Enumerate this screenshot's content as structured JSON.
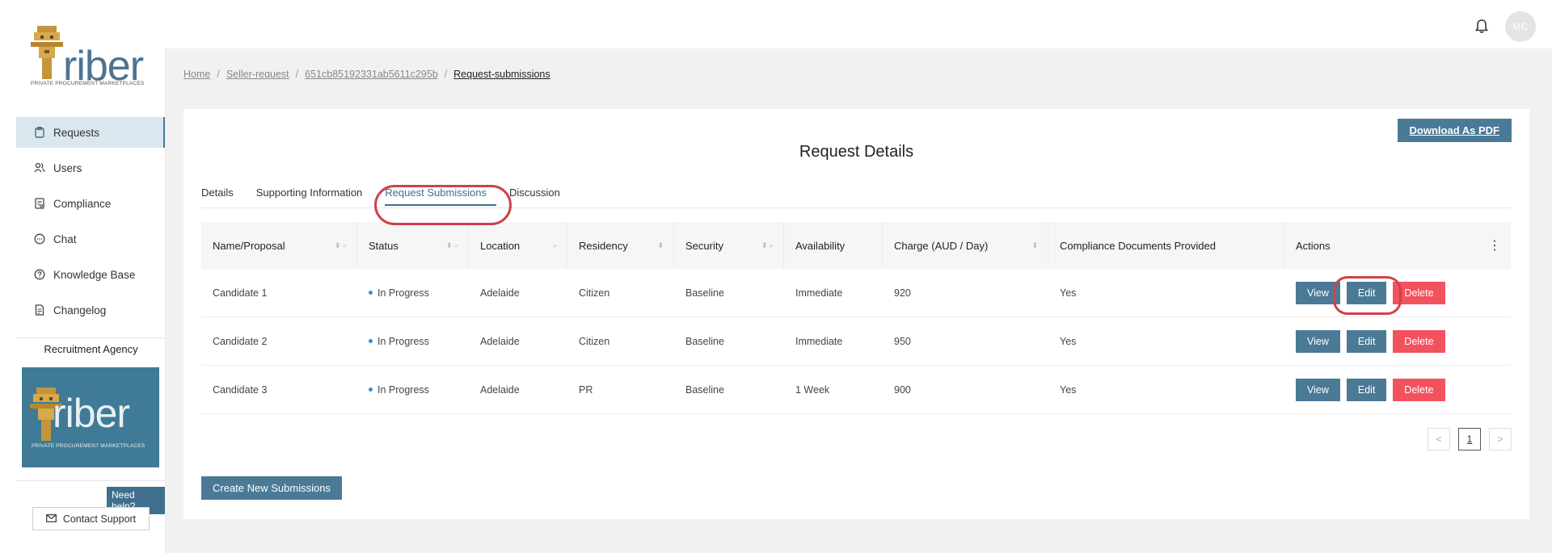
{
  "header": {
    "avatar_initials": "MC"
  },
  "brand": {
    "logo_text": "riber",
    "logo_sub": "PRIVATE PROCUREMENT MARKETPLACES"
  },
  "sidebar": {
    "items": [
      {
        "label": "Requests",
        "icon": "clipboard-icon",
        "active": true
      },
      {
        "label": "Users",
        "icon": "users-icon",
        "active": false
      },
      {
        "label": "Compliance",
        "icon": "compliance-icon",
        "active": false
      },
      {
        "label": "Chat",
        "icon": "chat-icon",
        "active": false
      },
      {
        "label": "Knowledge Base",
        "icon": "help-circle-icon",
        "active": false
      },
      {
        "label": "Changelog",
        "icon": "document-icon",
        "active": false
      }
    ],
    "agency_label": "Recruitment Agency",
    "need_help": "Need help?",
    "contact_support": "Contact Support"
  },
  "breadcrumb": {
    "home": "Home",
    "seller": "Seller-request",
    "id": "651cb85192331ab5611c295b",
    "current": "Request-submissions"
  },
  "card": {
    "download_pdf": "Download As PDF",
    "title": "Request Details",
    "tabs": [
      "Details",
      "Supporting Information",
      "Request Submissions",
      "Discussion"
    ],
    "active_tab": "Request Submissions"
  },
  "table": {
    "headers": [
      "Name/Proposal",
      "Status",
      "Location",
      "Residency",
      "Security",
      "Availability",
      "Charge (AUD / Day)",
      "Compliance Documents Provided",
      "Actions"
    ],
    "rows": [
      {
        "name": "Candidate 1",
        "status": "In Progress",
        "location": "Adelaide",
        "residency": "Citizen",
        "security": "Baseline",
        "availability": "Immediate",
        "charge": "920",
        "compliance": "Yes"
      },
      {
        "name": "Candidate 2",
        "status": "In Progress",
        "location": "Adelaide",
        "residency": "Citizen",
        "security": "Baseline",
        "availability": "Immediate",
        "charge": "950",
        "compliance": "Yes"
      },
      {
        "name": "Candidate 3",
        "status": "In Progress",
        "location": "Adelaide",
        "residency": "PR",
        "security": "Baseline",
        "availability": "1 Week",
        "charge": "900",
        "compliance": "Yes"
      }
    ],
    "actions": {
      "view": "View",
      "edit": "Edit",
      "delete": "Delete"
    }
  },
  "pager": {
    "prev": "<",
    "page": "1",
    "next": ">"
  },
  "create_button": "Create New Submissions",
  "colors": {
    "primary": "#4a7a96",
    "danger": "#f2525d",
    "highlight": "#d0414b",
    "status_dot": "#3c8dd0"
  }
}
